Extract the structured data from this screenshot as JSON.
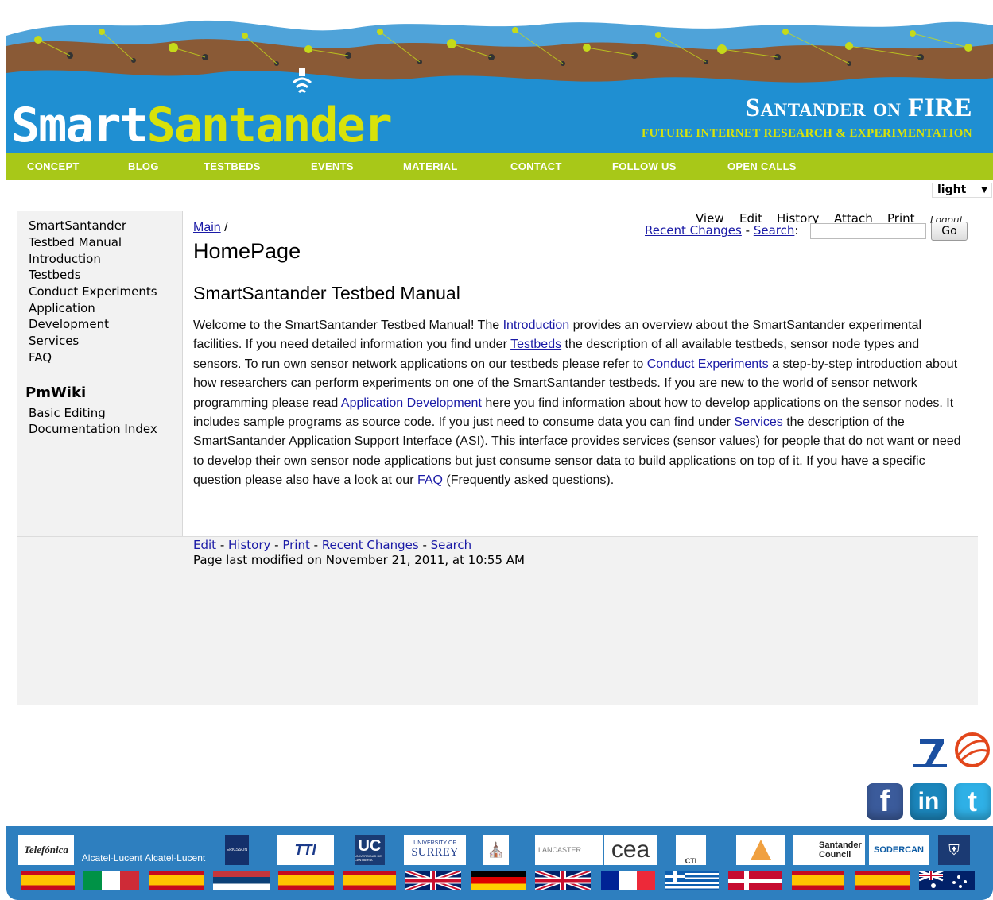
{
  "header": {
    "logo_smart": "Smart",
    "logo_santander": "Santander",
    "tagline": "Santander on FIRE",
    "subtitle": "FUTURE INTERNET RESEARCH & EXPERIMENTATION"
  },
  "nav": {
    "items": [
      "CONCEPT",
      "BLOG",
      "TESTBEDS",
      "EVENTS",
      "MATERIAL",
      "CONTACT",
      "FOLLOW US",
      "OPEN CALLS"
    ]
  },
  "skin_select": {
    "value": "light"
  },
  "sidebar": {
    "links": [
      "SmartSantander",
      "Testbed Manual",
      "Introduction",
      "Testbeds",
      "Conduct Experiments",
      "Application",
      "Development",
      "Services",
      "FAQ"
    ],
    "pmwiki_heading": "PmWiki",
    "pmwiki_links": [
      "Basic Editing",
      "Documentation Index"
    ]
  },
  "page_actions": {
    "view": "View",
    "edit": "Edit",
    "history": "History",
    "attach": "Attach",
    "print": "Print",
    "logout": "Logout",
    "recent_changes": "Recent Changes",
    "separator": " - ",
    "search_label": "Search",
    "search_colon": ":",
    "go": "Go"
  },
  "breadcrumb": {
    "group": "Main",
    "separator": " /"
  },
  "page": {
    "title": "HomePage",
    "section_title": "SmartSantander Testbed Manual",
    "body": [
      {
        "t": "Welcome to the SmartSantander Testbed Manual! The "
      },
      {
        "link": "Introduction"
      },
      {
        "t": " provides an overview about the SmartSantander experimental facilities. If you need detailed information you find under "
      },
      {
        "link": "Testbeds"
      },
      {
        "t": " the description of all available testbeds, sensor node types and sensors. To run own sensor network applications on our testbeds please refer to "
      },
      {
        "link": "Conduct Experiments"
      },
      {
        "t": " a step-by-step introduction about how researchers can perform experiments on one of the SmartSantander testbeds. If you are new to the world of sensor network programming please read "
      },
      {
        "link": "Application Development"
      },
      {
        "t": " here you find information about how to develop applications on the sensor nodes. It includes sample programs as source code. If you just need to consume data you can find under "
      },
      {
        "link": "Services"
      },
      {
        "t": " the description of the SmartSantander Application Support Interface (ASI). This interface provides services (sensor values) for people that do not want or need to develop their own sensor node applications but just consume sensor data to build applications on top of it. If you have a specific question please also have a look at our "
      },
      {
        "link": "FAQ"
      },
      {
        "t": " (Frequently asked questions)."
      }
    ]
  },
  "footer": {
    "links": [
      "Edit",
      "History",
      "Print",
      "Recent Changes",
      "Search"
    ],
    "separator": " - ",
    "last_modified": "Page last modified on November 21, 2011, at 10:55 AM"
  },
  "social": {
    "facebook": "f",
    "linkedin": "in",
    "twitter": "t"
  },
  "partners": {
    "telefonica": "Telefónica",
    "alcatel_1": "Alcatel-Lucent",
    "alcatel_2": "Alcatel-Lucent",
    "ericsson": "ERICSSON",
    "tti": "TTI",
    "uc": "UC",
    "uc_sub": "UNIVERSIDAD DE CANTABRIA",
    "surrey_1": "UNIVERSITY OF",
    "surrey_2": "SURREY",
    "lancaster": "LANCASTER",
    "cea": "cea",
    "cti": "CTI",
    "santander_council_1": "Santander",
    "santander_council_2": "Council",
    "sodercan": "SODERCAN"
  },
  "colors": {
    "header_blue": "#1f8fd2",
    "nav_green": "#a8c818",
    "accent_yellow": "#d8e20a",
    "link": "#1a1aa6",
    "partner_strip": "#2e7fbf"
  }
}
